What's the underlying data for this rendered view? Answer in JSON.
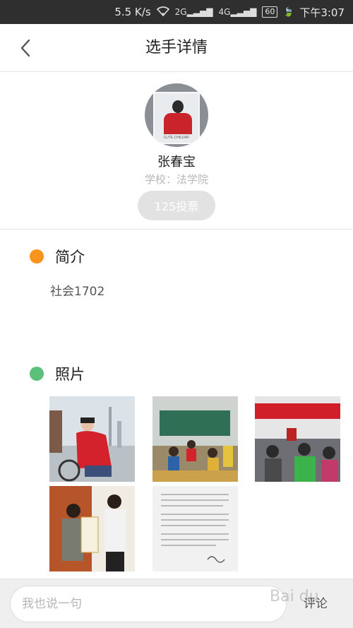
{
  "status_bar": {
    "network_speed": "5.5 K/s",
    "signal_1": "2G",
    "signal_2": "4G",
    "battery": "60",
    "time": "下午3:07"
  },
  "header": {
    "title": "选手详情",
    "back_icon": "chevron-left-icon"
  },
  "profile": {
    "avatar_caption": "CUTE CHILDRF",
    "name": "张春宝",
    "school": "学校：法学院",
    "votes_button": "125投票"
  },
  "intro": {
    "title": "简介",
    "dot_color": "#f7941d",
    "text": "社会1702"
  },
  "photos": {
    "title": "照片",
    "dot_color": "#5cc07a",
    "items": [
      {
        "icon": "photo-cycling"
      },
      {
        "icon": "photo-classroom"
      },
      {
        "icon": "photo-meeting"
      },
      {
        "icon": "photo-certificate"
      },
      {
        "icon": "photo-document"
      }
    ]
  },
  "comment_bar": {
    "placeholder": "我也说一句",
    "submit_label": "评论",
    "watermark": "Bai du"
  }
}
